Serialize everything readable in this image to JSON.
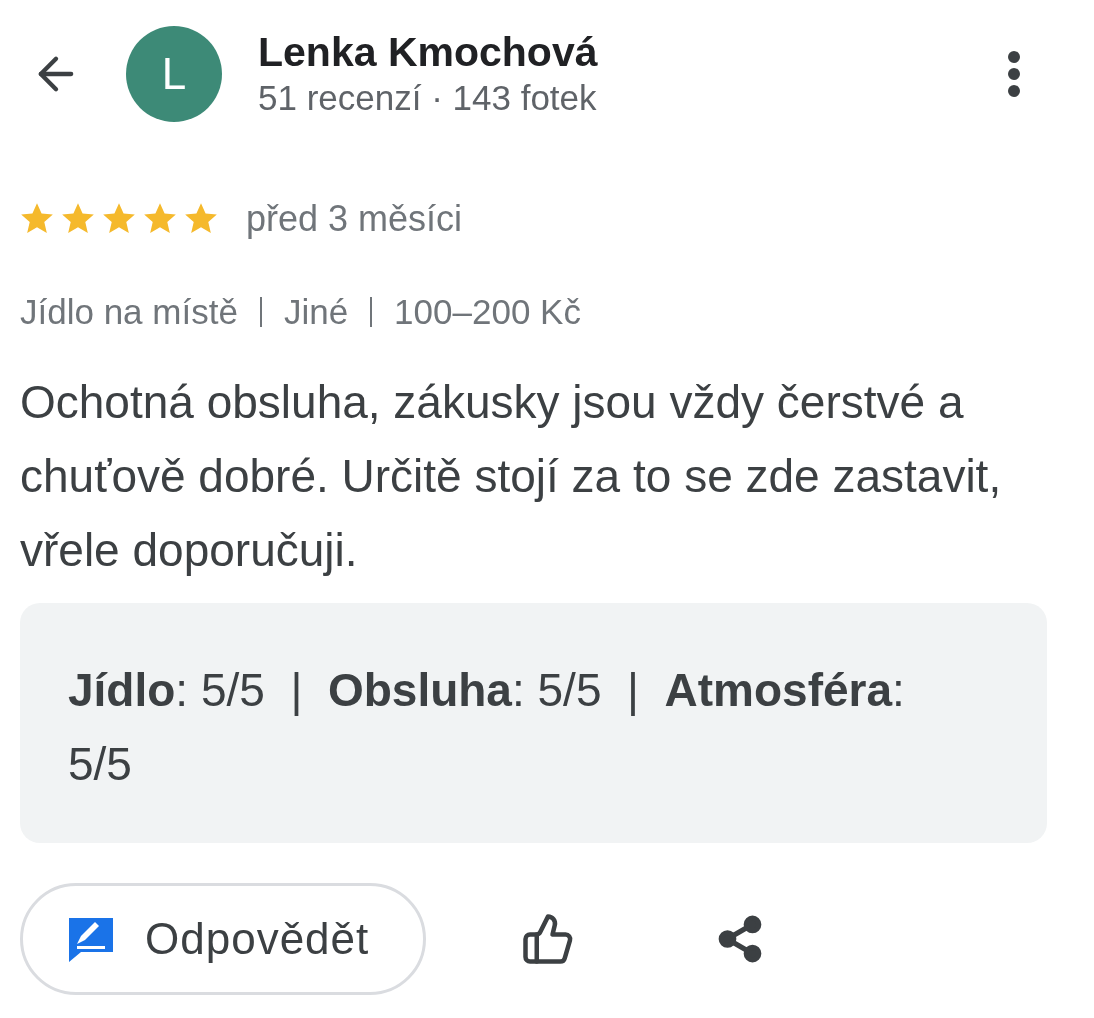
{
  "header": {
    "avatar_letter": "L",
    "name": "Lenka Kmochová",
    "subtitle": "51 recenzí · 143 fotek"
  },
  "review": {
    "stars": 5,
    "time": "před 3 měsíci",
    "tags": [
      "Jídlo na místě",
      "Jiné",
      "100–200 Kč"
    ],
    "text": "Ochotná obsluha, zákusky jsou vždy čerstvé a chuťově dobré. Určitě stojí za to se zde zastavit, vřele doporučuji.",
    "ratings": "**Jídlo**: 5/5  |  **Obsluha**: 5/5  |  **Atmosféra**: 5/5"
  },
  "actions": {
    "reply_label": "Odpovědět"
  }
}
